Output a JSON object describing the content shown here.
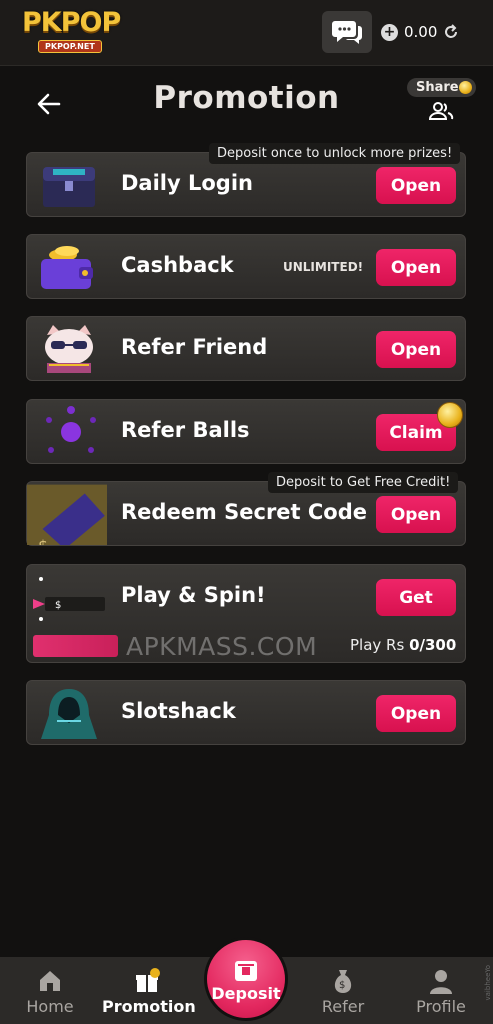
{
  "app": {
    "logo_main": "PKPOP",
    "logo_sub": "PKPOP.NET",
    "balance": "0.00"
  },
  "header": {
    "title": "Promotion",
    "share_label": "Share"
  },
  "promotions": [
    {
      "title": "Daily Login",
      "button": "Open",
      "tag": "Deposit once to unlock more prizes!"
    },
    {
      "title": "Cashback",
      "button": "Open",
      "badge": "UNLIMITED!"
    },
    {
      "title": "Refer Friend",
      "button": "Open"
    },
    {
      "title": "Refer Balls",
      "button": "Claim"
    },
    {
      "title": "Redeem Secret Code",
      "button": "Open",
      "tag": "Deposit to Get Free Credit!"
    },
    {
      "title": "Play & Spin!",
      "button": "Get",
      "play_label": "Play Rs ",
      "play_value": "0/300",
      "chip_label": "$"
    },
    {
      "title": "Slotshack",
      "button": "Open"
    }
  ],
  "watermark": "APKMASS.COM",
  "bottom_nav": {
    "home": "Home",
    "promotion": "Promotion",
    "deposit": "Deposit",
    "refer": "Refer",
    "profile": "Profile"
  },
  "side_text": "vaibheeYo",
  "colors": {
    "accent": "#e21a59",
    "background": "#121110",
    "card": "#33312e",
    "gold": "#f3c33a"
  }
}
